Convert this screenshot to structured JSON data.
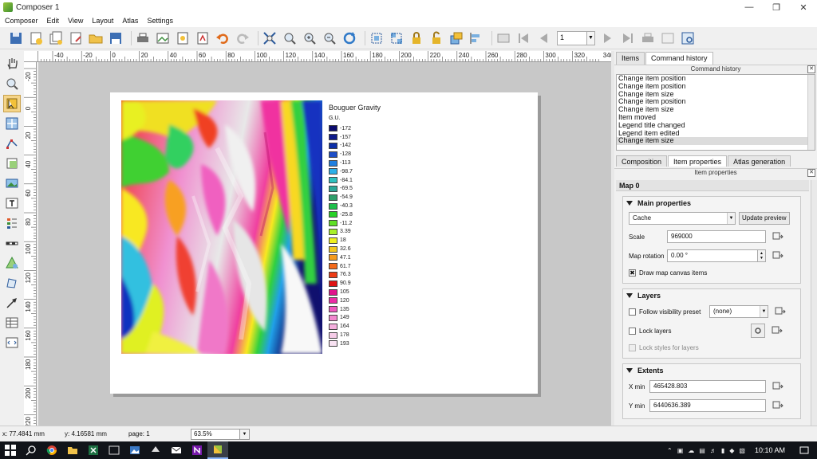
{
  "window": {
    "title": "Composer 1"
  },
  "menu": [
    "Composer",
    "Edit",
    "View",
    "Layout",
    "Atlas",
    "Settings"
  ],
  "toolbar": {
    "page_value": "1"
  },
  "rulers": {
    "h_labels": [
      "-40",
      "-20",
      "0",
      "20",
      "40",
      "60",
      "80",
      "100",
      "120",
      "140",
      "160",
      "180",
      "200",
      "220",
      "240",
      "260",
      "280",
      "300",
      "320",
      "340"
    ],
    "v_labels": [
      "-20",
      "0",
      "20",
      "40",
      "60",
      "80",
      "100",
      "120",
      "140",
      "160",
      "180",
      "200",
      "220"
    ]
  },
  "legend": {
    "title": "Bouguer Gravity",
    "units": "G.U.",
    "items": [
      {
        "label": "-172",
        "color": "#0c0c6e"
      },
      {
        "label": "-157",
        "color": "#0e1a8a"
      },
      {
        "label": "-142",
        "color": "#0d2fa8"
      },
      {
        "label": "-128",
        "color": "#1e4fc8"
      },
      {
        "label": "-113",
        "color": "#1f7fe0"
      },
      {
        "label": "-98.7",
        "color": "#2cb0e8"
      },
      {
        "label": "-84.1",
        "color": "#2ec2c0"
      },
      {
        "label": "-69.5",
        "color": "#2ba898"
      },
      {
        "label": "-54.9",
        "color": "#2f9f6b"
      },
      {
        "label": "-40.3",
        "color": "#1fbf4a"
      },
      {
        "label": "-25.8",
        "color": "#28d228"
      },
      {
        "label": "-11.2",
        "color": "#5fe026"
      },
      {
        "label": "3.39",
        "color": "#a8f02a"
      },
      {
        "label": "18",
        "color": "#f0f01e"
      },
      {
        "label": "32.6",
        "color": "#f4c81e"
      },
      {
        "label": "47.1",
        "color": "#f59b1e"
      },
      {
        "label": "61.7",
        "color": "#f46a1a"
      },
      {
        "label": "76.3",
        "color": "#ee3c16"
      },
      {
        "label": "90.9",
        "color": "#e01414"
      },
      {
        "label": "105",
        "color": "#e0148c"
      },
      {
        "label": "120",
        "color": "#ec2ca6"
      },
      {
        "label": "135",
        "color": "#f058c0"
      },
      {
        "label": "149",
        "color": "#f288cf"
      },
      {
        "label": "164",
        "color": "#f4aedd"
      },
      {
        "label": "178",
        "color": "#f6cce8"
      },
      {
        "label": "193",
        "color": "#f8e2f2"
      }
    ]
  },
  "right_panel": {
    "tabs": [
      "Items",
      "Command history"
    ],
    "history_title": "Command history",
    "history": [
      "Change item position",
      "Change item position",
      "Change item size",
      "Change item position",
      "Change item size",
      "Item moved",
      "Legend title changed",
      "Legend item edited",
      "Change item size"
    ],
    "tabs2": [
      "Composition",
      "Item properties",
      "Atlas generation"
    ],
    "props_title": "Item properties",
    "item_name": "Map 0",
    "main": {
      "header": "Main properties",
      "cache": "Cache",
      "update_preview": "Update preview",
      "scale_label": "Scale",
      "scale_value": "969000",
      "rotation_label": "Map rotation",
      "rotation_value": "0.00 °",
      "draw_canvas": "Draw map canvas items"
    },
    "layers": {
      "header": "Layers",
      "follow_preset": "Follow visibility preset",
      "preset_value": "(none)",
      "lock_layers": "Lock layers",
      "lock_styles": "Lock styles for layers"
    },
    "extents": {
      "header": "Extents",
      "xmin_label": "X min",
      "xmin_value": "465428.803",
      "ymin_label": "Y min",
      "ymin_value": "6440636.389"
    }
  },
  "status": {
    "x": "x: 77.4841 mm",
    "y": "y: 4.16581 mm",
    "page": "page: 1",
    "zoom": "63.5%"
  },
  "taskbar": {
    "time": "10:10 AM"
  }
}
